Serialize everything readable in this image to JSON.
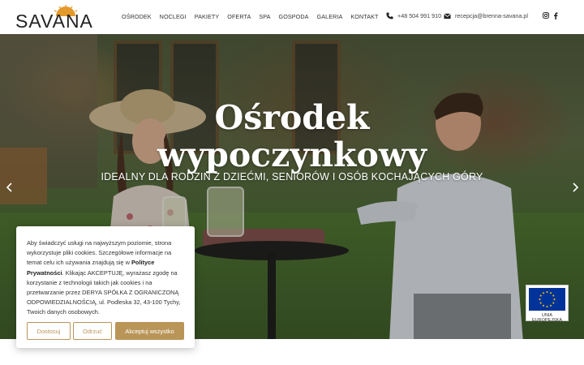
{
  "brand": {
    "logo_text": "SAVANA"
  },
  "nav": {
    "items": [
      {
        "label": "OŚRODEK"
      },
      {
        "label": "NOCLEGI"
      },
      {
        "label": "PAKIETY"
      },
      {
        "label": "OFERTA"
      },
      {
        "label": "SPA"
      },
      {
        "label": "GOSPODA"
      },
      {
        "label": "GALERIA"
      },
      {
        "label": "KONTAKT"
      }
    ]
  },
  "contact": {
    "phone": "+48 504 991 910",
    "email": "recepcja@brenna-savana.pl"
  },
  "social": {
    "icons": [
      "instagram-icon",
      "facebook-icon"
    ]
  },
  "hero": {
    "title_line1": "Ośrodek",
    "title_line2": "wypoczynkowy",
    "subtitle": "IDEALNY DLA RODZIN Z DZIEĆMI, SENIORÓW I OSÓB KOCHAJĄCYCH GÓRY"
  },
  "eu_badge": {
    "label": "UNIA EUROPEJSKA"
  },
  "cookie": {
    "text_part1": "Aby świadczyć usługi na najwyższym poziomie, strona wykorzystuje pliki cookies. Szczegółowe informacje na temat celu ich używania znajdują się w ",
    "policy_link": "Polityce Prywatności",
    "text_part2": ". Klikając AKCEPTUJĘ, wyrażasz zgodę na korzystanie z technologii takich jak cookies i na przetwarzanie przez DERYA SPÓŁKA Z OGRANICZONĄ ODPOWIEDZIALNOŚCIĄ, ul. Podleska 32, 43-100 Tychy, Twoich danych osobowych.",
    "btn_customize": "Dostosuj",
    "btn_reject": "Odrzuć",
    "btn_accept": "Akceptuj wszystko"
  },
  "colors": {
    "accent": "#b99558",
    "text": "#333333",
    "eu_blue": "#003399",
    "eu_star": "#ffcc00"
  }
}
